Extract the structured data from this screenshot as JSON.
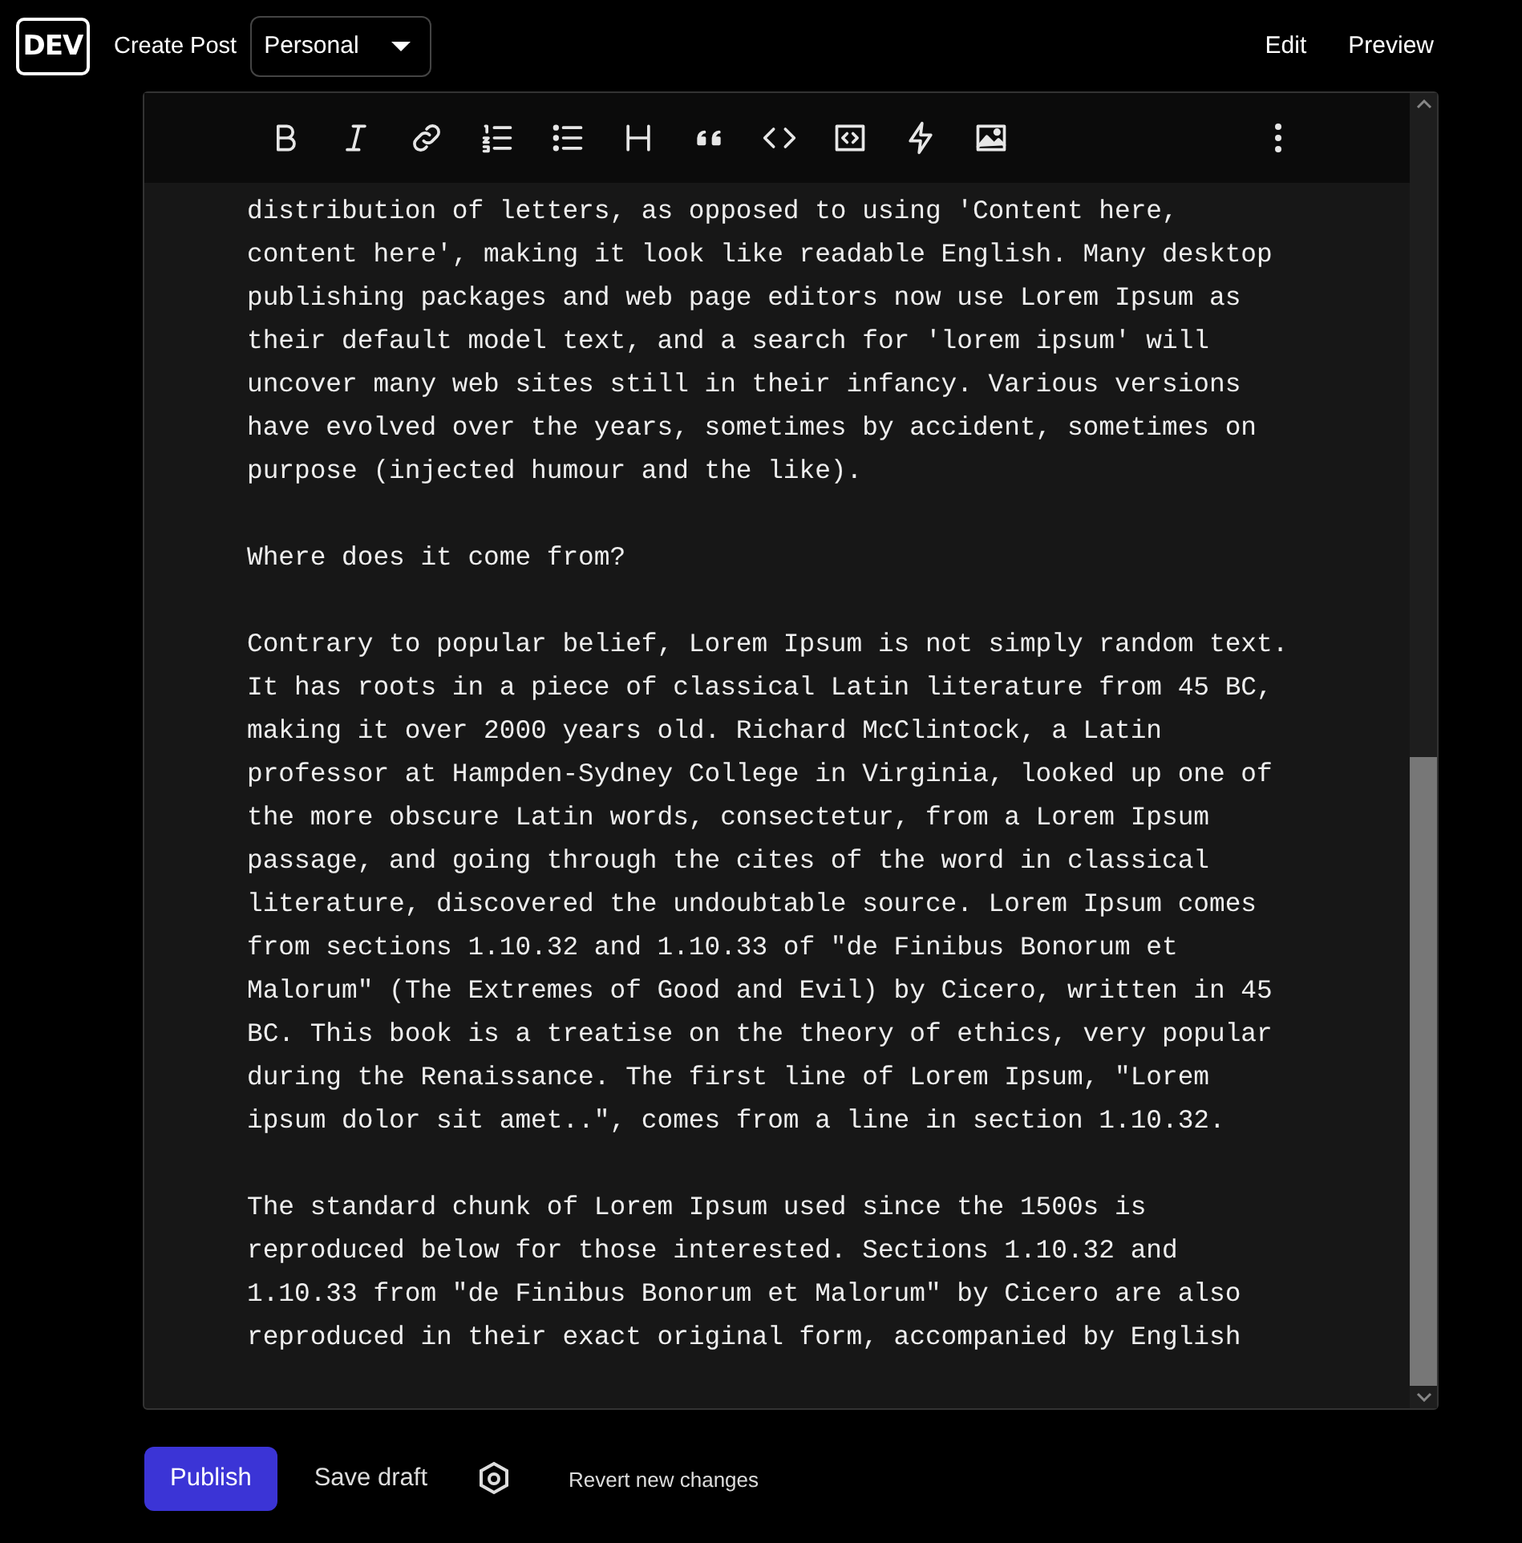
{
  "header": {
    "logo": "DEV",
    "title": "Create Post",
    "org_select": {
      "value": "Personal"
    },
    "tabs": [
      {
        "label": "Edit"
      },
      {
        "label": "Preview"
      }
    ]
  },
  "toolbar": {
    "tools": [
      {
        "kind": "bold"
      },
      {
        "kind": "italic"
      },
      {
        "kind": "link"
      },
      {
        "kind": "ordered-list"
      },
      {
        "kind": "bullet-list"
      },
      {
        "kind": "heading"
      },
      {
        "kind": "quote"
      },
      {
        "kind": "code"
      },
      {
        "kind": "code-block"
      },
      {
        "kind": "lightning"
      },
      {
        "kind": "image"
      }
    ]
  },
  "editor": {
    "paragraphs": [
      [
        "distribution of letters, as opposed to using 'Content here,",
        "content here', making it look like readable English. Many desktop",
        "publishing packages and web page editors now use Lorem Ipsum as",
        "their default model text, and a search for 'lorem ipsum' will",
        "uncover many web sites still in their infancy. Various versions",
        "have evolved over the years, sometimes by accident, sometimes on",
        "purpose (injected humour and the like)."
      ],
      [
        "Where does it come from?"
      ],
      [
        "Contrary to popular belief, Lorem Ipsum is not simply random text.",
        "It has roots in a piece of classical Latin literature from 45 BC,",
        "making it over 2000 years old. Richard McClintock, a Latin",
        "professor at Hampden-Sydney College in Virginia, looked up one of",
        "the more obscure Latin words, consectetur, from a Lorem Ipsum",
        "passage, and going through the cites of the word in classical",
        "literature, discovered the undoubtable source. Lorem Ipsum comes",
        "from sections 1.10.32 and 1.10.33 of \"de Finibus Bonorum et",
        "Malorum\" (The Extremes of Good and Evil) by Cicero, written in 45",
        "BC. This book is a treatise on the theory of ethics, very popular",
        "during the Renaissance. The first line of Lorem Ipsum, \"Lorem",
        "ipsum dolor sit amet..\", comes from a line in section 1.10.32."
      ],
      [
        "The standard chunk of Lorem Ipsum used since the 1500s is",
        "reproduced below for those interested. Sections 1.10.32 and",
        "1.10.33 from \"de Finibus Bonorum et Malorum\" by Cicero are also",
        "reproduced in their exact original form, accompanied by English"
      ]
    ]
  },
  "actions": {
    "publish": "Publish",
    "save_draft": "Save draft",
    "revert": "Revert new changes"
  }
}
